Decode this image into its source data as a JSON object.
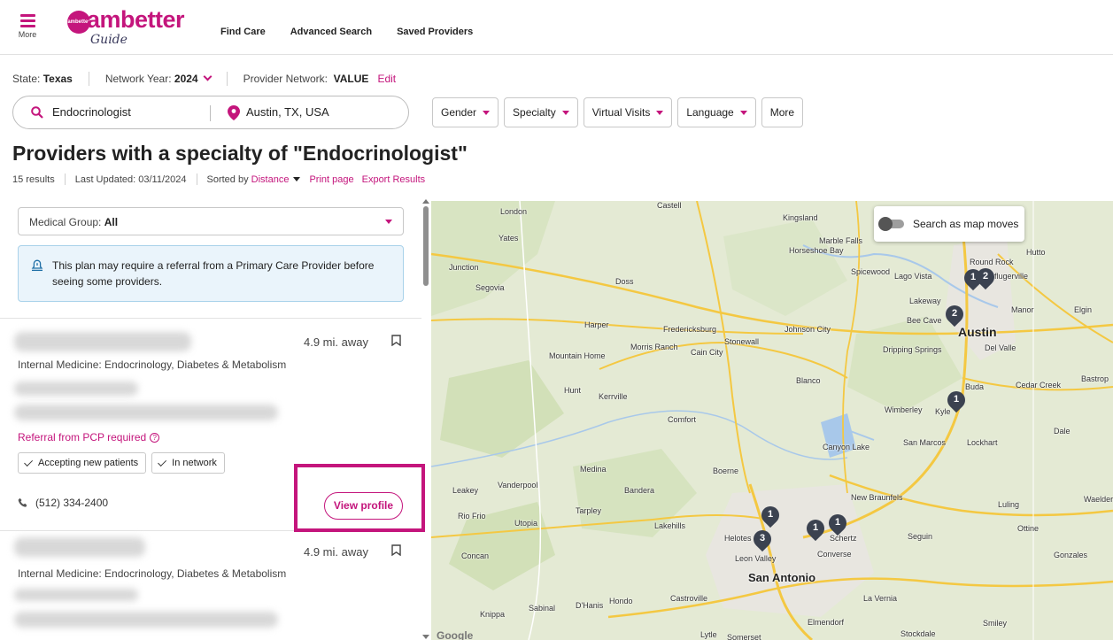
{
  "header": {
    "menu_label": "More",
    "logo_text": "ambetter",
    "logo_badge": "ambetter",
    "logo_sub": "Guide",
    "nav": [
      "Find Care",
      "Advanced Search",
      "Saved Providers"
    ]
  },
  "context": {
    "state_label": "State:",
    "state_value": "Texas",
    "network_year_label": "Network Year:",
    "network_year_value": "2024",
    "provider_network_label": "Provider Network:",
    "provider_network_value": "VALUE",
    "edit_label": "Edit"
  },
  "search": {
    "query": "Endocrinologist",
    "location": "Austin, TX, USA"
  },
  "filters": [
    "Gender",
    "Specialty",
    "Virtual Visits",
    "Language",
    "More"
  ],
  "results": {
    "title": "Providers with a specialty of \"Endocrinologist\"",
    "count": "15 results",
    "last_updated": "Last Updated: 03/11/2024",
    "sorted_by_label": "Sorted by",
    "sorted_by_value": "Distance",
    "print_label": "Print page",
    "export_label": "Export Results"
  },
  "list": {
    "group_label": "Medical Group:",
    "group_value": "All",
    "notice": "This plan may require a referral from a Primary Care Provider before seeing some providers.",
    "cards": [
      {
        "distance": "4.9 mi. away",
        "specialty": "Internal Medicine: Endocrinology, Diabetes & Metabolism",
        "referral": "Referral from PCP required",
        "tags": [
          "Accepting new patients",
          "In network"
        ],
        "phone": "(512) 334-2400",
        "view_label": "View profile"
      },
      {
        "distance": "4.9 mi. away",
        "specialty": "Internal Medicine: Endocrinology, Diabetes & Metabolism"
      }
    ]
  },
  "map": {
    "toggle_label": "Search as map moves",
    "attribution": "Google",
    "colors": {
      "brand": "#c4157c",
      "marker": "#3b4250",
      "land": "#e4ead4",
      "road": "#f4c842"
    },
    "labels": {
      "castell": "Castell",
      "kingsland": "Kingsland",
      "london": "London",
      "yates": "Yates",
      "marble_falls": "Marble Falls",
      "horseshoe_bay": "Horseshoe Bay",
      "hutto": "Hutto",
      "round_rock": "Round Rock",
      "pflugerville": "Pflugerville",
      "junction": "Junction",
      "doss": "Doss",
      "spicewood": "Spicewood",
      "lago_vista": "Lago Vista",
      "segovia": "Segovia",
      "lakeway": "Lakeway",
      "manor": "Manor",
      "elgin": "Elgin",
      "bee_cave": "Bee Cave",
      "harper": "Harper",
      "fredericksburg": "Fredericksburg",
      "johnson_city": "Johnson City",
      "austin": "Austin",
      "stonewall": "Stonewall",
      "morris_ranch": "Morris Ranch",
      "cain_city": "Cain City",
      "dripping_springs": "Dripping Springs",
      "del_valle": "Del Valle",
      "mountain_home": "Mountain Home",
      "blanco": "Blanco",
      "cedar_creek": "Cedar Creek",
      "bastrop": "Bastrop",
      "hunt": "Hunt",
      "kerrville": "Kerrville",
      "buda": "Buda",
      "kyle": "Kyle",
      "wimberley": "Wimberley",
      "comfort": "Comfort",
      "dale": "Dale",
      "san_marcos": "San Marcos",
      "lockhart": "Lockhart",
      "canyon_lake": "Canyon Lake",
      "medina": "Medina",
      "vanderpool": "Vanderpool",
      "boerne": "Boerne",
      "bandera": "Bandera",
      "leakey": "Leakey",
      "new_braunfels": "New Braunfels",
      "luling": "Luling",
      "waelder": "Waelder",
      "rio_frio": "Rio Frio",
      "tarpley": "Tarpley",
      "utopia": "Utopia",
      "lakehills": "Lakehills",
      "helotes": "Helotes",
      "schertz": "Schertz",
      "seguin": "Seguin",
      "ottine": "Ottine",
      "concan": "Concan",
      "leon_valley": "Leon Valley",
      "converse": "Converse",
      "gonzales": "Gonzales",
      "san_antonio": "San Antonio",
      "castroville": "Castroville",
      "hondo": "Hondo",
      "d_hanis": "D'Hanis",
      "sabinal": "Sabinal",
      "knippa": "Knippa",
      "la_vernia": "La Vernia",
      "elmendorf": "Elmendorf",
      "smiley": "Smiley",
      "lytle": "Lytle",
      "somerset": "Somerset",
      "stockdale": "Stockdale"
    },
    "markers": [
      "1",
      "2",
      "2",
      "1",
      "1",
      "3",
      "1",
      "1"
    ]
  }
}
